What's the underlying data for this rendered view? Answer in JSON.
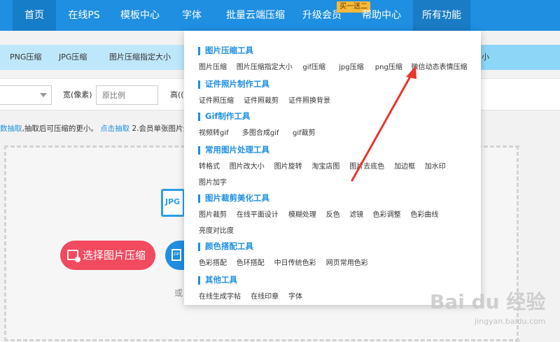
{
  "nav": {
    "items": [
      "首页",
      "在线PS",
      "模板中心",
      "字体",
      "批量云端压缩",
      "升级会员",
      "帮助中心",
      "所有功能"
    ],
    "badge": "买一送二"
  },
  "subtabs": [
    "PNG压缩",
    "JPG压缩",
    "图片压缩指定大小"
  ],
  "subtab_more": "小",
  "form": {
    "width_label": "宽(像素)",
    "width_placeholder": "原比例",
    "height_label": "高(("
  },
  "tip": {
    "part1": "数抽取",
    "part2": ",抽取后可压缩的更小。",
    "part3": "点击抽取",
    "part4": " 2.会员单张图片最"
  },
  "upload": {
    "jpg_icon": "JPG",
    "choose_label": "选择图片压缩",
    "zip_icon": "ZIP",
    "or": "或"
  },
  "menu": {
    "categories": [
      {
        "title": "图片压缩工具",
        "rows": [
          [
            "图片压缩",
            "图片压缩指定大小",
            "gif压缩",
            "jpg压缩",
            "png压缩",
            "微信动态表情压缩"
          ]
        ]
      },
      {
        "title": "证件照片制作工具",
        "rows": [
          [
            "证件照压缩",
            "证件照裁剪",
            "证件照换背景"
          ]
        ]
      },
      {
        "title": "Gif制作工具",
        "rows": [
          [
            "视频转gif",
            "多图合成gif",
            "gif裁剪"
          ]
        ]
      },
      {
        "title": "常用图片处理工具",
        "rows": [
          [
            "转格式",
            "图片改大小",
            "图片旋转",
            "淘宝店图",
            "图片去底色",
            "加边框",
            "加水印"
          ],
          [
            "图片加字"
          ]
        ]
      },
      {
        "title": "图片裁剪美化工具",
        "rows": [
          [
            "图片裁剪",
            "在线平面设计",
            "模糊处理",
            "反色",
            "滤镜",
            "色彩调整",
            "色彩曲线"
          ],
          [
            "亮度对比度"
          ]
        ]
      },
      {
        "title": "颜色搭配工具",
        "rows": [
          [
            "色彩搭配",
            "色环搭配",
            "中日传统色彩",
            "网页常用色彩"
          ]
        ]
      },
      {
        "title": "其他工具",
        "rows": [
          [
            "在线生成字帖",
            "在线印章",
            "字体"
          ]
        ]
      }
    ]
  },
  "watermark": {
    "logo": "Bai du 经验",
    "url": "jingyan.baidu.com"
  },
  "colors": {
    "nav_bg": "#1e8fe1",
    "accent_red": "#f24a5e",
    "annotation_arrow": "#e8362c",
    "badge_bg": "#f6b93b"
  }
}
